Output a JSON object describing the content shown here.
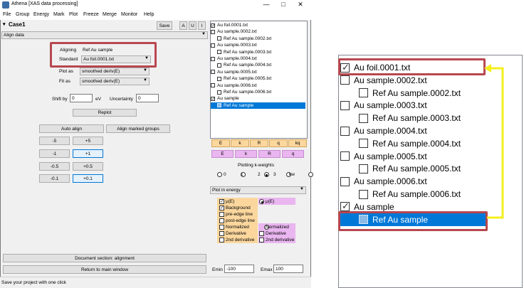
{
  "window": {
    "title": "Athena [XAS data processing]",
    "controls": [
      "—",
      "□",
      "✕"
    ]
  },
  "menu": [
    "File",
    "Group",
    "Energy",
    "Mark",
    "Plot",
    "Freeze",
    "Merge",
    "Monitor",
    "Help"
  ],
  "header": {
    "group_name": "Case1",
    "save_label": "Save",
    "mark_buttons": [
      "A",
      "U",
      "I"
    ]
  },
  "tool_selector": "Align data",
  "align": {
    "aligning_label": "Aligning",
    "aligning_value": "Ref Au sample",
    "standard_label": "Standard",
    "standard_value": "Au foil.0001.txt",
    "plot_as_label": "Plot as",
    "plot_as_value": "smoothed deriv(E)",
    "fit_as_label": "Fit as",
    "fit_as_value": "smoothed deriv(E)",
    "shift_label": "Shift by",
    "shift_value": "0",
    "shift_unit": "eV",
    "uncertainty_label": "Uncertainty",
    "uncertainty_value": "0",
    "replot_label": "Replot",
    "auto_align_label": "Auto align",
    "align_marked_label": "Align marked groups",
    "shift_buttons": [
      [
        "-5",
        "+5"
      ],
      [
        "-1",
        "+1"
      ],
      [
        "-0.5",
        "+0.5"
      ],
      [
        "-0.1",
        "+0.1"
      ]
    ],
    "doc_label": "Document section: alignment",
    "return_label": "Return to main window"
  },
  "status": "Save your project with one click",
  "groups": [
    {
      "label": "Au foil.0001.txt",
      "checked": true,
      "indent": false,
      "selected": false
    },
    {
      "label": "Au sample.0002.txt",
      "checked": false,
      "indent": false,
      "selected": false
    },
    {
      "label": "Ref Au sample.0002.txt",
      "checked": false,
      "indent": true,
      "selected": false
    },
    {
      "label": "Au sample.0003.txt",
      "checked": false,
      "indent": false,
      "selected": false
    },
    {
      "label": "Ref Au sample.0003.txt",
      "checked": false,
      "indent": true,
      "selected": false
    },
    {
      "label": "Au sample.0004.txt",
      "checked": false,
      "indent": false,
      "selected": false
    },
    {
      "label": "Ref Au sample.0004.txt",
      "checked": false,
      "indent": true,
      "selected": false
    },
    {
      "label": "Au sample.0005.txt",
      "checked": false,
      "indent": false,
      "selected": false
    },
    {
      "label": "Ref Au sample.0005.txt",
      "checked": false,
      "indent": true,
      "selected": false
    },
    {
      "label": "Au sample.0006.txt",
      "checked": false,
      "indent": false,
      "selected": false
    },
    {
      "label": "Ref Au sample.0006.txt",
      "checked": false,
      "indent": true,
      "selected": false
    },
    {
      "label": "Au sample",
      "checked": true,
      "indent": false,
      "selected": false
    },
    {
      "label": "Ref Au sample",
      "checked": false,
      "indent": true,
      "selected": true
    }
  ],
  "plot_buttons": {
    "orange": [
      "E",
      "k",
      "R",
      "q",
      "kq"
    ],
    "pink": [
      "E",
      "k",
      "R",
      "q"
    ]
  },
  "kweights": {
    "label": "Plotting k-weights",
    "options": [
      "0",
      "1",
      "2",
      "3",
      "kw"
    ],
    "selected": "2"
  },
  "plot_space": "Plot in energy",
  "energy_options": {
    "left": [
      {
        "label": "μ(E)",
        "checked": true
      },
      {
        "label": "Background",
        "checked": true
      },
      {
        "label": "pre-edge line",
        "checked": false
      },
      {
        "label": "post-edge line",
        "checked": false
      },
      {
        "label": "Normalized",
        "checked": false
      },
      {
        "label": "Derivative",
        "checked": false
      },
      {
        "label": "2nd derivative",
        "checked": false
      }
    ],
    "right": [
      {
        "label": "μ(E)",
        "type": "radio",
        "checked": true
      },
      {
        "label": "Normalized",
        "type": "radio",
        "checked": false
      },
      {
        "label": "Derivative",
        "type": "check",
        "checked": false
      },
      {
        "label": "2nd derivative",
        "type": "check",
        "checked": false
      }
    ]
  },
  "emin_label": "Emin",
  "emin_value": "-100",
  "emax_label": "Emax",
  "emax_value": "100",
  "colors": {
    "highlight_red": "#b7474f",
    "arrow_yellow": "#f5ef1c",
    "selection_blue": "#0078d7",
    "orange": "#fbd79e",
    "pink": "#e9b6f0"
  }
}
